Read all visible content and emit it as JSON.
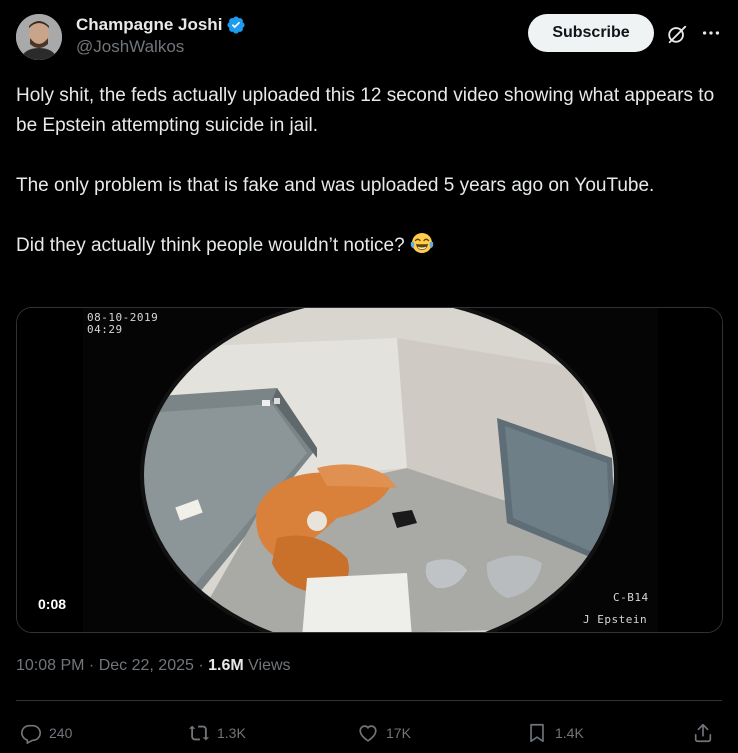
{
  "author": {
    "display_name": "Champagne Joshi",
    "handle": "@JoshWalkos",
    "verified_icon": "verified-badge-icon"
  },
  "header": {
    "subscribe_label": "Subscribe",
    "grok_icon": "grok-icon",
    "more_icon": "more-icon"
  },
  "post": {
    "paragraph_1": "Holy shit, the feds actually uploaded this 12 second video showing what appears to be Epstein attempting suicide in jail.",
    "paragraph_2": "The only problem is that is fake and was uploaded 5 years ago on YouTube.",
    "paragraph_3": "Did they actually think people wouldn’t notice?",
    "emoji": "face-with-tears-of-joy"
  },
  "media": {
    "cctv_date": "08-10-2019",
    "cctv_time": "04:29",
    "cctv_camera": "C-B14",
    "cctv_name": "J Epstein",
    "duration": "0:08"
  },
  "meta": {
    "time": "10:08 PM",
    "separator": " · ",
    "date": "Dec 22, 2025",
    "views_count": "1.6M",
    "views_label": " Views"
  },
  "actions": {
    "replies": "240",
    "reposts": "1.3K",
    "likes": "17K",
    "bookmarks": "1.4K"
  },
  "colors": {
    "background": "#000000",
    "text_primary": "#e7e9ea",
    "text_secondary": "#71767b",
    "verified_blue": "#1d9bf0",
    "subscribe_bg": "#eff3f4",
    "divider": "#2f3336"
  }
}
